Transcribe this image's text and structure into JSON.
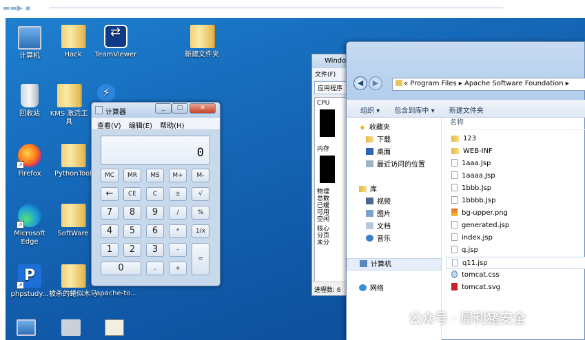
{
  "desktop_icons": [
    {
      "label": "计算机"
    },
    {
      "label": "Hack"
    },
    {
      "label": "TeamViewer"
    },
    {
      "label": "新建文件夹"
    },
    {
      "label": "回收站"
    },
    {
      "label": "KMS 激活工具"
    },
    {
      "label": "Firefox"
    },
    {
      "label": "PythonTool"
    },
    {
      "label": "Microsoft Edge"
    },
    {
      "label": "SoftWare"
    },
    {
      "label": "phpstudy..."
    },
    {
      "label": "被杀的蜷似木马"
    },
    {
      "label": "apache-to..."
    }
  ],
  "calculator": {
    "title": "计算器",
    "menu": [
      "查看(V)",
      "编辑(E)",
      "帮助(H)"
    ],
    "display": "0",
    "keys": [
      "MC",
      "MR",
      "MS",
      "M+",
      "M-",
      "←",
      "CE",
      "C",
      "±",
      "√",
      "7",
      "8",
      "9",
      "/",
      "%",
      "4",
      "5",
      "6",
      "*",
      "1/x",
      "1",
      "2",
      "3",
      "-",
      "=",
      "0",
      ".",
      "+"
    ]
  },
  "taskmgr": {
    "title": "Windo",
    "menu": "文件(F)",
    "tab": "应用程序",
    "cpu": "CPU",
    "mem": "内存",
    "stats": [
      "物理",
      "总数",
      "已缓",
      "可用",
      "空闲",
      "核心",
      "分页",
      "未分"
    ],
    "status": "进程数: 6"
  },
  "explorer": {
    "address": "« Program Files ▸ Apache Software Foundation ▸",
    "toolbar": [
      "组织 ▾",
      "包含到库中 ▾",
      "新建文件夹"
    ],
    "nav": [
      "收藏夹",
      "下载",
      "桌面",
      "最近访问的位置",
      "库",
      "视频",
      "图片",
      "文档",
      "音乐",
      "计算机",
      "网络"
    ],
    "column_header": "名称",
    "files": [
      {
        "name": "123",
        "type": "fold"
      },
      {
        "name": "WEB-INF",
        "type": "fold"
      },
      {
        "name": "1aaa.Jsp",
        "type": "doc"
      },
      {
        "name": "1aaaa.Jsp",
        "type": "doc"
      },
      {
        "name": "1bbb.Jsp",
        "type": "doc"
      },
      {
        "name": "1bbbb.Jsp",
        "type": "doc"
      },
      {
        "name": "bg-upper.png",
        "type": "img"
      },
      {
        "name": "generated.jsp",
        "type": "doc"
      },
      {
        "name": "index.jsp",
        "type": "doc"
      },
      {
        "name": "q.jsp",
        "type": "doc"
      },
      {
        "name": "q11.jsp",
        "type": "doc"
      },
      {
        "name": "tomcat.css",
        "type": "css"
      },
      {
        "name": "tomcat.svg",
        "type": "svg"
      }
    ]
  },
  "watermark": "公众号 · 犀利猪安全"
}
